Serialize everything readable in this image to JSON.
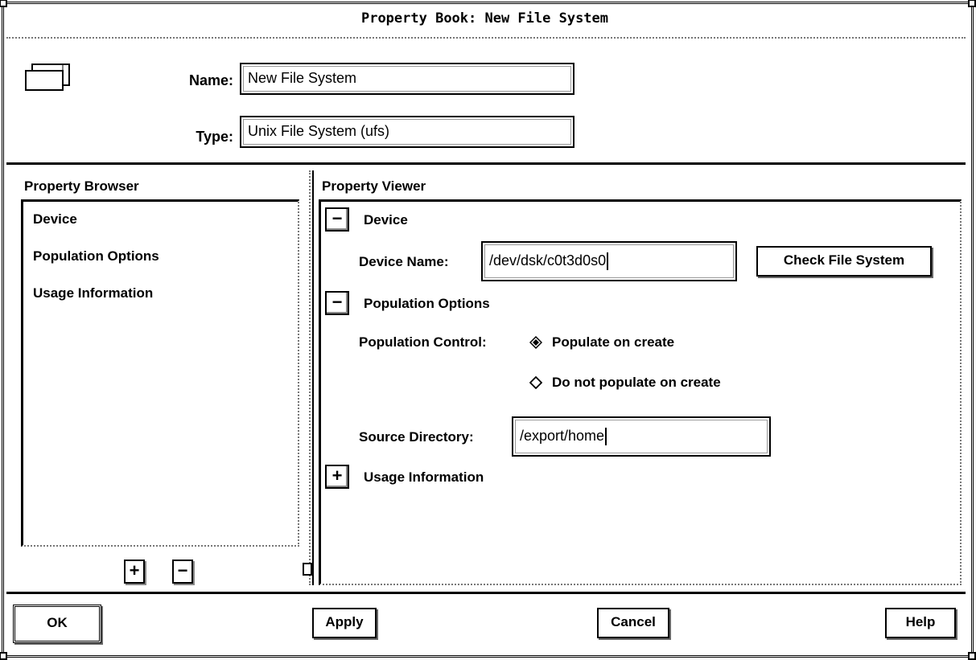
{
  "window": {
    "title": "Property Book: New File System"
  },
  "header": {
    "icon": "folder-icon",
    "name_label": "Name:",
    "name_value": "New File System",
    "type_label": "Type:",
    "type_value": "Unix File System (ufs)"
  },
  "browser": {
    "title": "Property Browser",
    "items": [
      {
        "label": "Device"
      },
      {
        "label": "Population Options"
      },
      {
        "label": "Usage Information"
      }
    ],
    "expand_label": "+",
    "collapse_label": "−"
  },
  "viewer": {
    "title": "Property Viewer",
    "device": {
      "toggle": "−",
      "label": "Device",
      "device_name_label": "Device Name:",
      "device_name_value": "/dev/dsk/c0t3d0s0",
      "check_button": "Check File System"
    },
    "population": {
      "toggle": "−",
      "label": "Population Options",
      "control_label": "Population Control:",
      "options": [
        {
          "label": "Populate on create",
          "selected": true
        },
        {
          "label": "Do not populate on create",
          "selected": false
        }
      ],
      "source_label": "Source Directory:",
      "source_value": "/export/home"
    },
    "usage": {
      "toggle": "+",
      "label": "Usage Information"
    }
  },
  "footer": {
    "ok": "OK",
    "apply": "Apply",
    "cancel": "Cancel",
    "help": "Help"
  }
}
